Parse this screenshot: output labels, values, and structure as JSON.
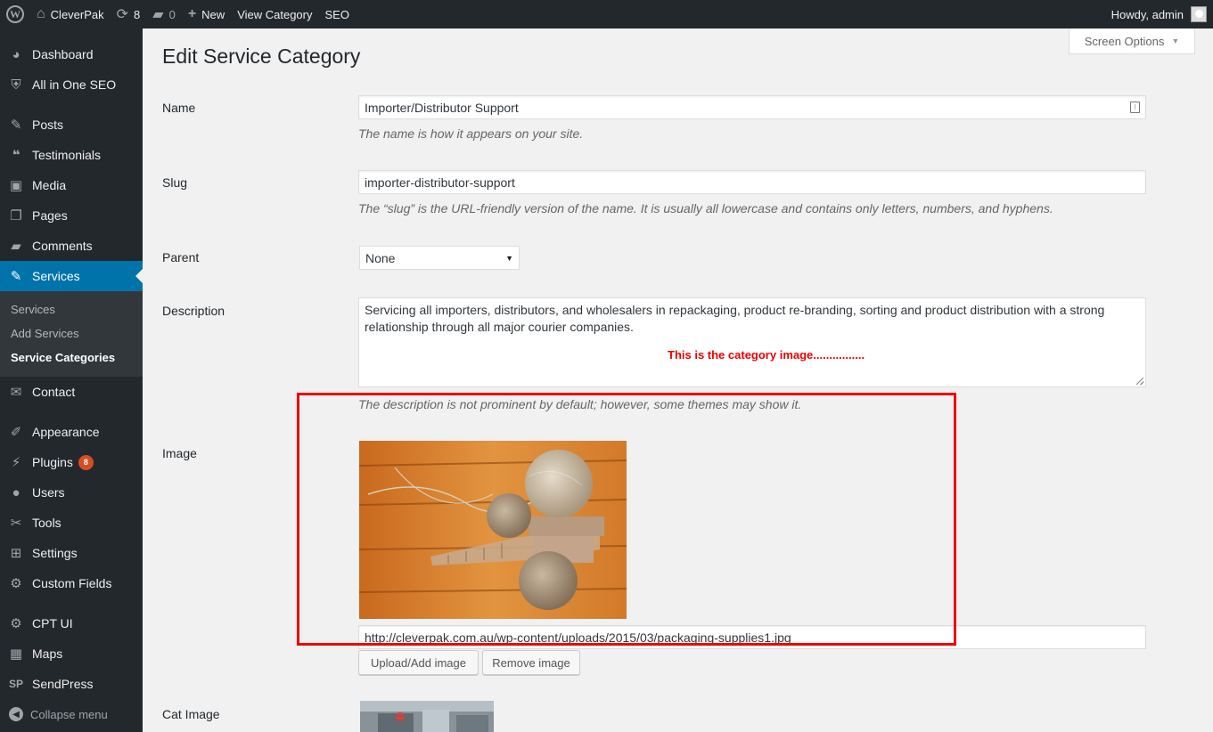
{
  "admin_bar": {
    "site_name": "CleverPak",
    "updates_count": "8",
    "comments_count": "0",
    "new_label": "New",
    "view_category": "View Category",
    "seo": "SEO",
    "howdy": "Howdy, admin"
  },
  "sidebar": {
    "items": [
      {
        "label": "Dashboard",
        "icon": "dashboard-icon"
      },
      {
        "label": "All in One SEO",
        "icon": "shield-icon"
      },
      {
        "label": "Posts",
        "icon": "pin-icon"
      },
      {
        "label": "Testimonials",
        "icon": "quote-icon"
      },
      {
        "label": "Media",
        "icon": "media-icon"
      },
      {
        "label": "Pages",
        "icon": "pages-icon"
      },
      {
        "label": "Comments",
        "icon": "comment-icon"
      },
      {
        "label": "Services",
        "icon": "pin-icon"
      },
      {
        "label": "Contact",
        "icon": "mail-icon"
      },
      {
        "label": "Appearance",
        "icon": "brush-icon"
      },
      {
        "label": "Plugins",
        "icon": "plugin-icon"
      },
      {
        "label": "Users",
        "icon": "user-icon"
      },
      {
        "label": "Tools",
        "icon": "wrench-icon"
      },
      {
        "label": "Settings",
        "icon": "settings-icon"
      },
      {
        "label": "Custom Fields",
        "icon": "gear-icon"
      },
      {
        "label": "CPT UI",
        "icon": "gear-icon"
      },
      {
        "label": "Maps",
        "icon": "map-icon"
      },
      {
        "label": "SendPress",
        "icon": "sendpress-icon"
      }
    ],
    "plugins_badge": "8",
    "submenu": [
      "Services",
      "Add Services",
      "Service Categories"
    ],
    "collapse": "Collapse menu"
  },
  "screen_options": "Screen Options",
  "page_title": "Edit Service Category",
  "form": {
    "name_label": "Name",
    "name_value": "Importer/Distributor Support",
    "name_hint": "The name is how it appears on your site.",
    "slug_label": "Slug",
    "slug_value": "importer-distributor-support",
    "slug_hint": "The “slug” is the URL-friendly version of the name. It is usually all lowercase and contains only letters, numbers, and hyphens.",
    "parent_label": "Parent",
    "parent_value": "None",
    "description_label": "Description",
    "description_value": "Servicing all importers, distributors, and wholesalers in repackaging, product re-branding, sorting and product distribution with a strong relationship through all major courier companies.",
    "description_hint": "The description is not prominent by default; however, some themes may show it.",
    "image_label": "Image",
    "image_url": "http://cleverpak.com.au/wp-content/uploads/2015/03/packaging-supplies1.jpg",
    "upload_button": "Upload/Add image",
    "remove_button": "Remove image",
    "cat_image_label": "Cat Image"
  },
  "annotation": "This is the category image................",
  "colors": {
    "admin_bar": "#23282d",
    "active_menu": "#0073aa",
    "annotation_red": "#e00000",
    "badge": "#d54e21"
  }
}
